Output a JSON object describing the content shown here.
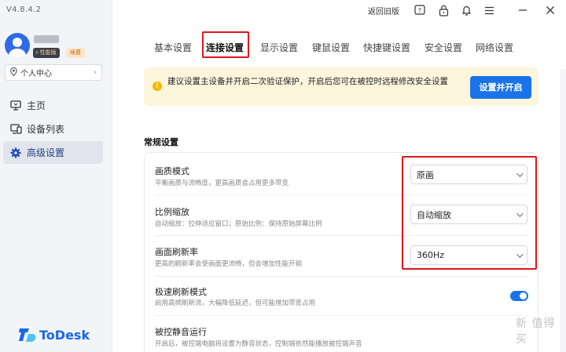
{
  "app": {
    "version": "V4.8.4.2",
    "logo_text": "ToDesk",
    "brand_color": "#1767ea"
  },
  "user": {
    "perf_badge": "性能版",
    "renew_badge": "续费",
    "personal_center": "个人中心"
  },
  "sidebar": {
    "items": [
      {
        "label": "主页",
        "icon": "monitor-icon"
      },
      {
        "label": "设备列表",
        "icon": "devices-icon"
      },
      {
        "label": "高级设置",
        "icon": "gear-icon"
      }
    ]
  },
  "topbar": {
    "return_old": "返回旧版",
    "icons": [
      "help-icon",
      "lock-icon",
      "bell-icon",
      "menu-icon",
      "minimize-icon",
      "close-icon"
    ]
  },
  "tabs": [
    "基本设置",
    "连接设置",
    "显示设置",
    "键鼠设置",
    "快捷键设置",
    "安全设置",
    "网络设置"
  ],
  "active_tab": "连接设置",
  "notice": {
    "text": "建议设置主设备并开启二次验证保护，开启后您可在被控时远程修改安全设置",
    "button": "设置并开启"
  },
  "section": {
    "title": "常规设置",
    "rows": [
      {
        "title": "画质模式",
        "desc": "平衡画质与流畅度，更高画质会占用更多带宽",
        "value": "原画"
      },
      {
        "title": "比例缩放",
        "desc": "自动缩放：拉伸适应窗口；原始比例：保持原始屏幕比例",
        "value": "自动缩放"
      },
      {
        "title": "画面刷新率",
        "desc": "更高的刷新率会使画面更流畅，但会增加性能开销",
        "value": "360Hz"
      },
      {
        "title": "极速刷新模式",
        "desc": "启用高频刷新流，大幅降低延迟，但可能增加带宽占用",
        "toggle": true
      },
      {
        "title": "被控静音运行",
        "desc": "开启后，被控端电脑将设置为静音状态，控制端依然能播放被控端声音"
      }
    ]
  },
  "watermark": "新 值得买"
}
